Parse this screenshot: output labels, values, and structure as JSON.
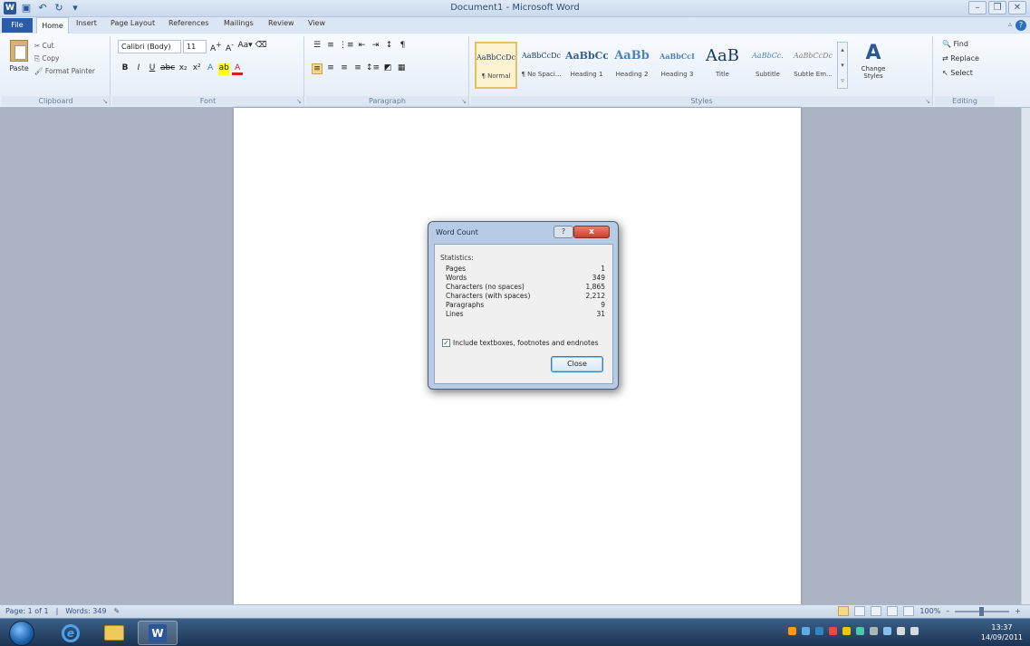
{
  "window": {
    "title": "Document1 - Microsoft Word"
  },
  "tabs": {
    "file": "File",
    "home": "Home",
    "insert": "Insert",
    "page_layout": "Page Layout",
    "references": "References",
    "mailings": "Mailings",
    "review": "Review",
    "view": "View"
  },
  "ribbon": {
    "clipboard": {
      "label": "Clipboard",
      "paste": "Paste",
      "cut": "Cut",
      "copy": "Copy",
      "format_painter": "Format Painter"
    },
    "font": {
      "label": "Font",
      "font_name": "Calibri (Body)",
      "font_size": "11"
    },
    "paragraph": {
      "label": "Paragraph"
    },
    "styles": {
      "label": "Styles",
      "items": [
        {
          "sample": "AaBbCcDc",
          "name": "¶ Normal"
        },
        {
          "sample": "AaBbCcDc",
          "name": "¶ No Spaci..."
        },
        {
          "sample": "AaBbCc",
          "name": "Heading 1"
        },
        {
          "sample": "AaBb",
          "name": "Heading 2"
        },
        {
          "sample": "AaBbCcI",
          "name": "Heading 3"
        },
        {
          "sample": "AaB",
          "name": "Title"
        },
        {
          "sample": "AaBbCc.",
          "name": "Subtitle"
        },
        {
          "sample": "AaBbCcDc",
          "name": "Subtle Em..."
        }
      ],
      "change_styles": "Change Styles"
    },
    "editing": {
      "label": "Editing",
      "find": "Find",
      "replace": "Replace",
      "select": "Select"
    }
  },
  "dialog": {
    "title": "Word Count",
    "help": "?",
    "close_x": "x",
    "statistics_label": "Statistics:",
    "stats": [
      {
        "name": "Pages",
        "value": "1"
      },
      {
        "name": "Words",
        "value": "349"
      },
      {
        "name": "Characters (no spaces)",
        "value": "1,865"
      },
      {
        "name": "Characters (with spaces)",
        "value": "2,212"
      },
      {
        "name": "Paragraphs",
        "value": "9"
      },
      {
        "name": "Lines",
        "value": "31"
      }
    ],
    "include_label": "Include textboxes, footnotes and endnotes",
    "include_checked": true,
    "close_button": "Close"
  },
  "status": {
    "page": "Page: 1 of 1",
    "words": "Words: 349",
    "zoom": "100%"
  },
  "taskbar": {
    "clock_time": "13:37",
    "clock_date": "14/09/2011"
  },
  "colors": {
    "accent": "#2b579a",
    "file_tab": "#2a5ca8",
    "close_red": "#c8402c"
  }
}
